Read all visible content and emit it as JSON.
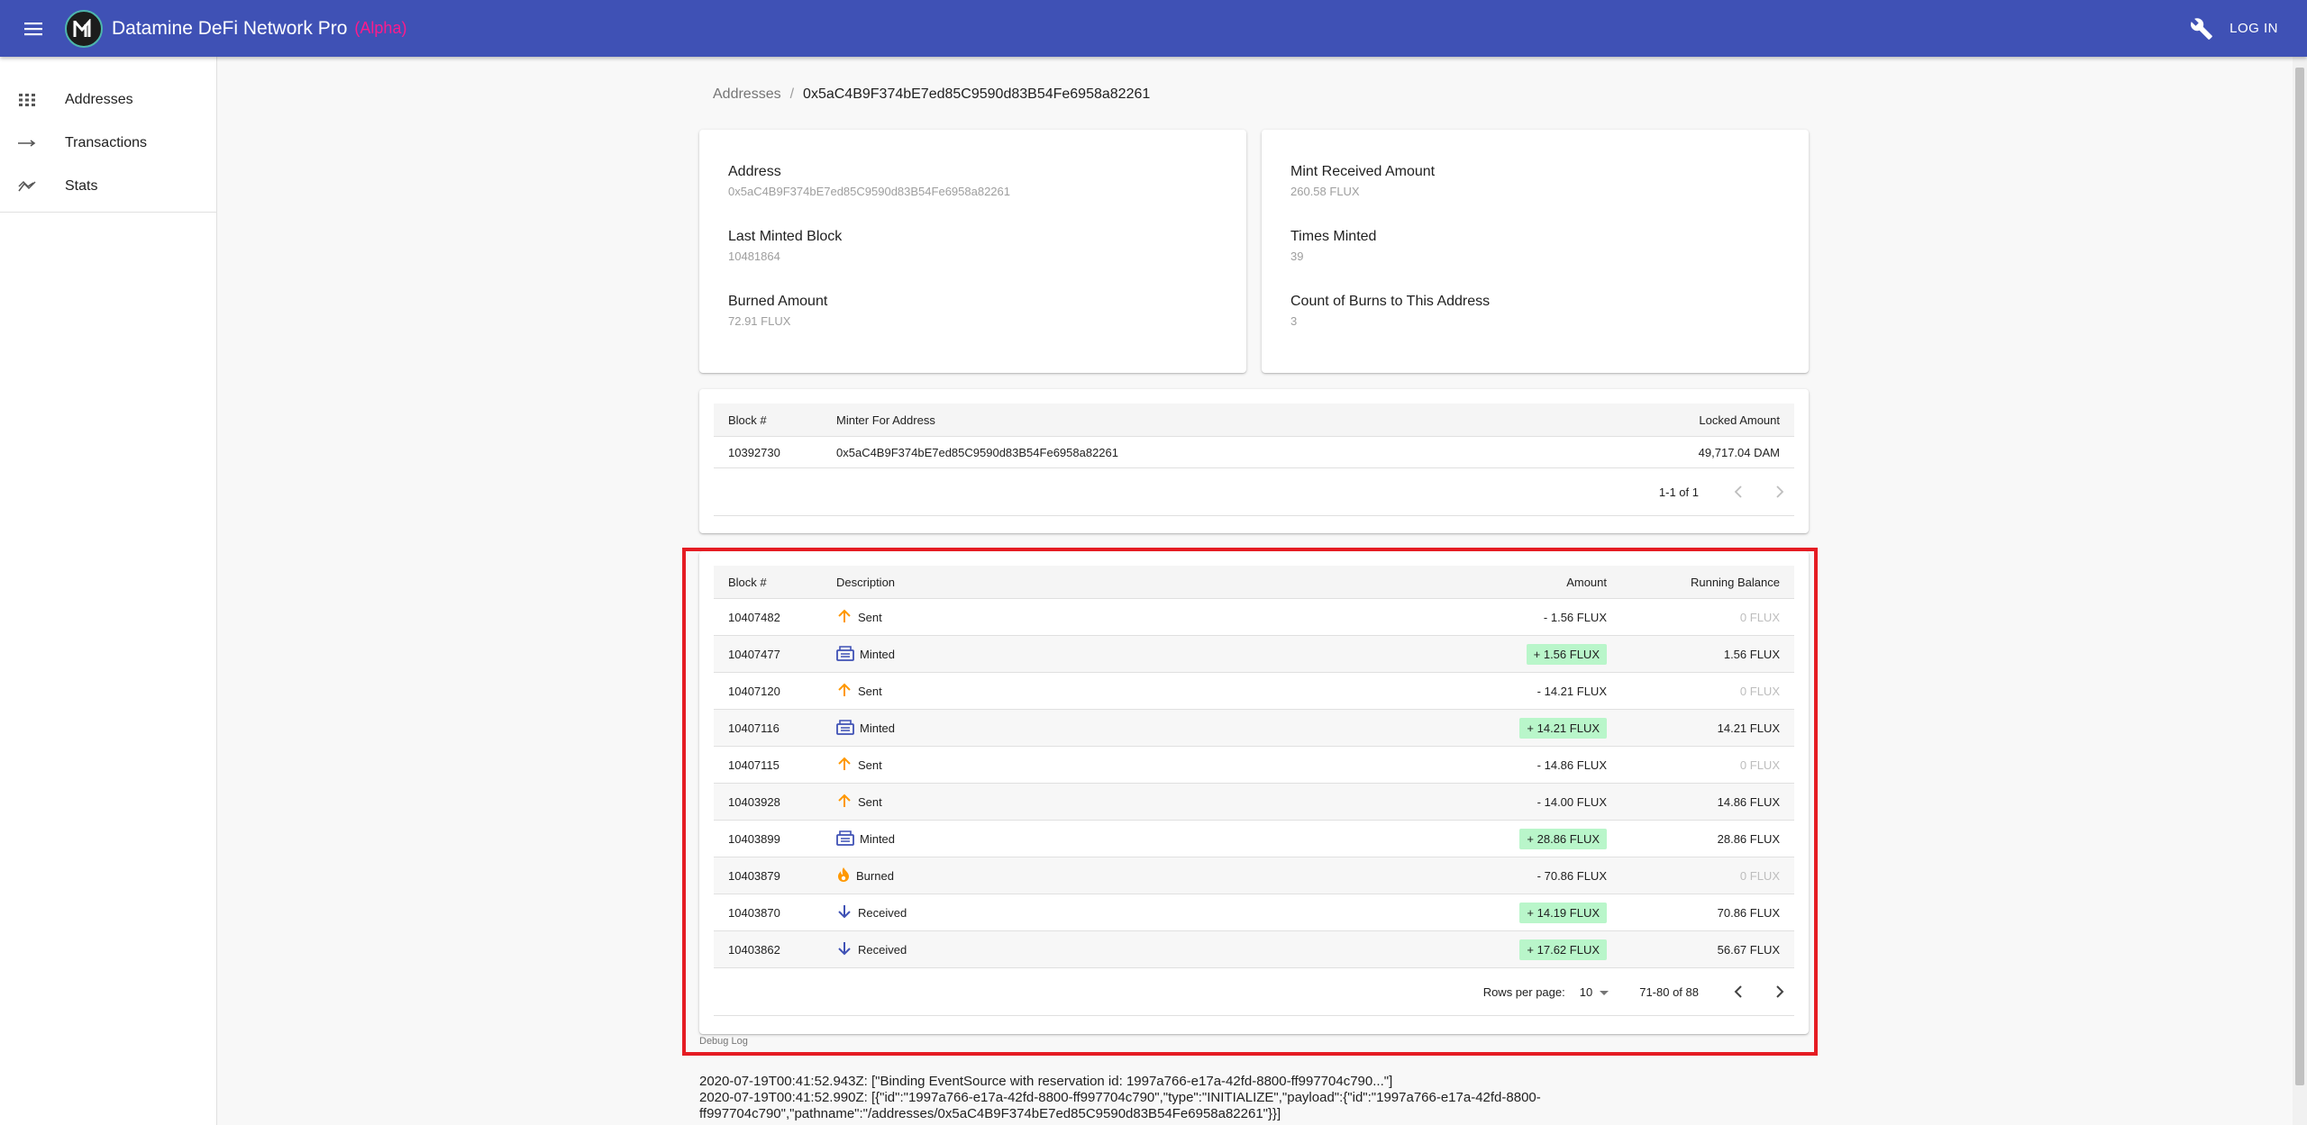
{
  "app": {
    "title": "Datamine DeFi Network Pro",
    "badge": "(Alpha)",
    "login_label": "LOG IN"
  },
  "sidebar": {
    "items": [
      {
        "label": "Addresses",
        "icon": "grid-icon"
      },
      {
        "label": "Transactions",
        "icon": "arrow-right-icon"
      },
      {
        "label": "Stats",
        "icon": "trend-icon"
      }
    ]
  },
  "breadcrumb": {
    "parent": "Addresses",
    "separator": "/",
    "current": "0x5aC4B9F374bE7ed85C9590d83B54Fe6958a82261"
  },
  "summary_left": {
    "address_label": "Address",
    "address_value": "0x5aC4B9F374bE7ed85C9590d83B54Fe6958a82261",
    "last_block_label": "Last Minted Block",
    "last_block_value": "10481864",
    "burned_label": "Burned Amount",
    "burned_value": "72.91 FLUX"
  },
  "summary_right": {
    "mint_received_label": "Mint Received Amount",
    "mint_received_value": "260.58 FLUX",
    "times_minted_label": "Times Minted",
    "times_minted_value": "39",
    "burns_count_label": "Count of Burns to This Address",
    "burns_count_value": "3"
  },
  "minter_table": {
    "headers": [
      "Block #",
      "Minter For Address",
      "Locked Amount"
    ],
    "rows": [
      {
        "block": "10392730",
        "minter": "0x5aC4B9F374bE7ed85C9590d83B54Fe6958a82261",
        "locked": "49,717.04 DAM"
      }
    ],
    "range": "1-1 of 1"
  },
  "tx_table": {
    "headers": [
      "Block #",
      "Description",
      "Amount",
      "Running Balance"
    ],
    "rows": [
      {
        "block": "10407482",
        "type": "Sent",
        "amount": "- 1.56 FLUX",
        "balance": "0 FLUX"
      },
      {
        "block": "10407477",
        "type": "Minted",
        "amount": "+ 1.56 FLUX",
        "balance": "1.56 FLUX"
      },
      {
        "block": "10407120",
        "type": "Sent",
        "amount": "- 14.21 FLUX",
        "balance": "0 FLUX"
      },
      {
        "block": "10407116",
        "type": "Minted",
        "amount": "+ 14.21 FLUX",
        "balance": "14.21 FLUX"
      },
      {
        "block": "10407115",
        "type": "Sent",
        "amount": "- 14.86 FLUX",
        "balance": "0 FLUX"
      },
      {
        "block": "10403928",
        "type": "Sent",
        "amount": "- 14.00 FLUX",
        "balance": "14.86 FLUX"
      },
      {
        "block": "10403899",
        "type": "Minted",
        "amount": "+ 28.86 FLUX",
        "balance": "28.86 FLUX"
      },
      {
        "block": "10403879",
        "type": "Burned",
        "amount": "- 70.86 FLUX",
        "balance": "0 FLUX"
      },
      {
        "block": "10403870",
        "type": "Received",
        "amount": "+ 14.19 FLUX",
        "balance": "70.86 FLUX"
      },
      {
        "block": "10403862",
        "type": "Received",
        "amount": "+ 17.62 FLUX",
        "balance": "56.67 FLUX"
      }
    ],
    "rows_per_page_label": "Rows per page:",
    "rows_per_page": "10",
    "range": "71-80 of 88"
  },
  "debug": {
    "title": "Debug Log",
    "lines": [
      "2020-07-19T00:41:52.943Z: [\"Binding EventSource with reservation id: 1997a766-e17a-42fd-8800-ff997704c790...\"]",
      "2020-07-19T00:41:52.990Z: [{\"id\":\"1997a766-e17a-42fd-8800-ff997704c790\",\"type\":\"INITIALIZE\",\"payload\":{\"id\":\"1997a766-e17a-42fd-8800-ff997704c790\",\"pathname\":\"/addresses/0x5aC4B9F374bE7ed85C9590d83B54Fe6958a82261\"}}]"
    ]
  },
  "colors": {
    "appbar": "#3f51b5",
    "alpha": "#ff1a8c",
    "positive_chip": "#b9f6ca",
    "sent_icon": "#ff9800",
    "minted_icon": "#3f51b5",
    "burned_icon": "#ff9800",
    "received_icon": "#3f51b5",
    "highlight": "#e51c23"
  }
}
